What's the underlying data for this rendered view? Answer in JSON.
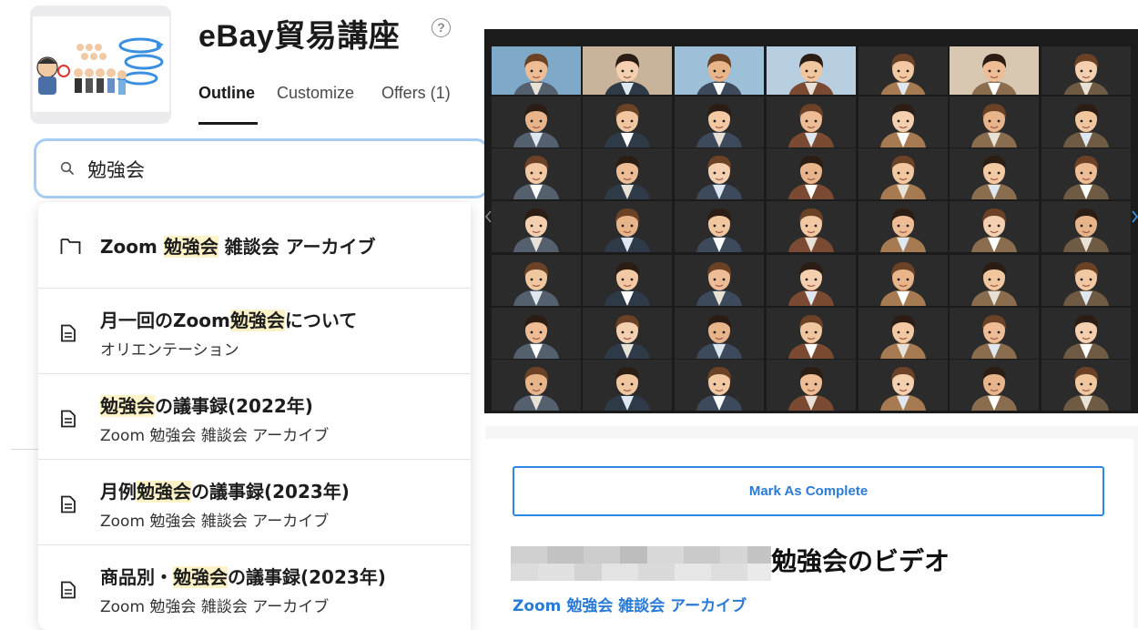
{
  "course": {
    "title": "eBay貿易講座",
    "help_icon": "question-circle-icon"
  },
  "tabs": [
    {
      "label": "Outline",
      "active": true
    },
    {
      "label": "Customize",
      "active": false
    },
    {
      "label": "Offers (1)",
      "active": false
    }
  ],
  "search": {
    "icon": "search-icon",
    "value": "勉強会"
  },
  "results": [
    {
      "type": "folder",
      "icon": "folder-icon",
      "title_parts": [
        "Zoom ",
        "勉強会",
        " 雑談会 アーカイブ"
      ],
      "subtitle": ""
    },
    {
      "type": "lesson",
      "icon": "document-icon",
      "title_parts": [
        "月一回のZoom",
        "勉強会",
        "について"
      ],
      "subtitle": "オリエンテーション"
    },
    {
      "type": "lesson",
      "icon": "document-icon",
      "title_parts": [
        "",
        "勉強会",
        "の議事録(2022年)"
      ],
      "subtitle": "Zoom 勉強会 雑談会 アーカイブ"
    },
    {
      "type": "lesson",
      "icon": "document-icon",
      "title_parts": [
        "月例",
        "勉強会",
        "の議事録(2023年)"
      ],
      "subtitle": "Zoom 勉強会 雑談会 アーカイブ"
    },
    {
      "type": "lesson",
      "icon": "document-icon",
      "title_parts": [
        "商品別・",
        "勉強会",
        "の議事録(2023年)"
      ],
      "subtitle": "Zoom 勉強会 雑談会 アーカイブ"
    }
  ],
  "lesson": {
    "mark_complete_label": "Mark As Complete",
    "title": "勉強会のビデオ",
    "section_link": "Zoom 勉強会 雑談会 アーカイブ"
  },
  "colors": {
    "accent": "#2a7bd6",
    "search_focus": "#a8cdf2",
    "highlight": "#fdf3c6",
    "video_bg": "#1b1b1b"
  }
}
